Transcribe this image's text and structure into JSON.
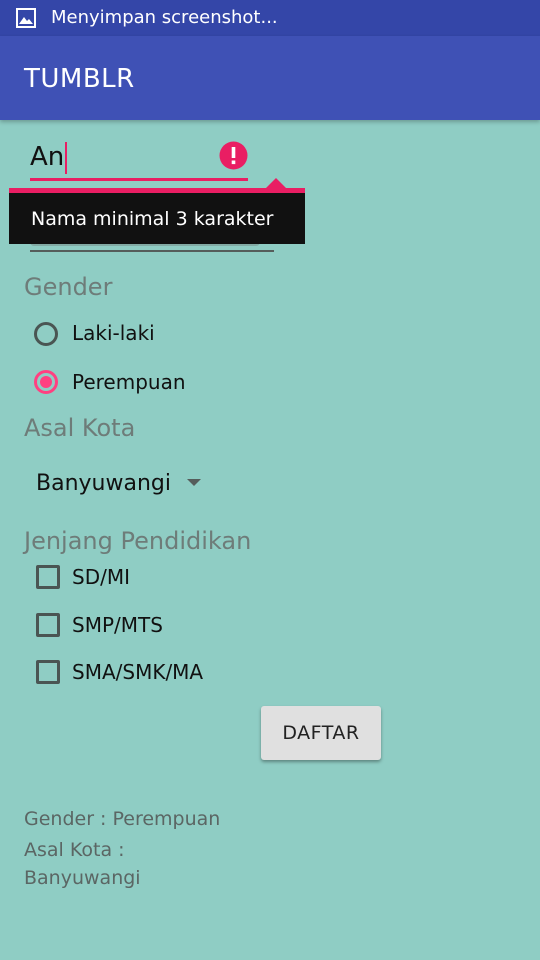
{
  "status_bar": {
    "icon": "image-icon",
    "text": "Menyimpan screenshot..."
  },
  "app_bar": {
    "title": "TUMBLR"
  },
  "form": {
    "name_input": {
      "value": "An",
      "error_icon": "exclamation-circle-icon",
      "error_message": "Nama minimal 3 karakter"
    },
    "gender": {
      "label": "Gender",
      "options": [
        "Laki-laki",
        "Perempuan"
      ],
      "selected": "Perempuan"
    },
    "kota": {
      "label": "Asal Kota",
      "selected": "Banyuwangi"
    },
    "jenjang": {
      "label": "Jenjang Pendidikan",
      "options": [
        "SD/MI",
        "SMP/MTS",
        "SMA/SMK/MA"
      ]
    },
    "submit_label": "DAFTAR"
  },
  "result": {
    "gender_line": "Gender : Perempuan",
    "kota_line": "Asal Kota :",
    "kota_value": "Banyuwangi"
  },
  "colors": {
    "background": "#8fcdc4",
    "app_bar": "#3f51b5",
    "status_bar": "#3446a8",
    "accent": "#ff4081",
    "error": "#e91e63"
  }
}
